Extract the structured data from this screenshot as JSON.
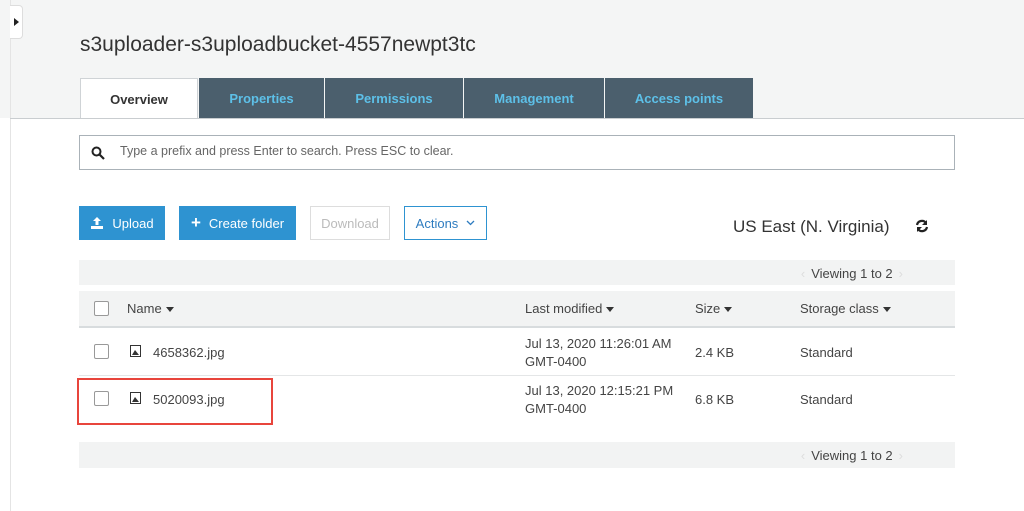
{
  "bucket_title": "s3uploader-s3uploadbucket-4557newpt3tc",
  "tabs": [
    {
      "label": "Overview",
      "active": true
    },
    {
      "label": "Properties"
    },
    {
      "label": "Permissions"
    },
    {
      "label": "Management"
    },
    {
      "label": "Access points"
    }
  ],
  "search": {
    "placeholder": "Type a prefix and press Enter to search. Press ESC to clear.",
    "value": ""
  },
  "toolbar": {
    "upload": "Upload",
    "create_folder": "Create folder",
    "download": "Download",
    "actions": "Actions"
  },
  "region": "US East (N. Virginia)",
  "pagination": {
    "top": "Viewing 1 to 2",
    "bottom": "Viewing 1 to 2"
  },
  "columns": {
    "name": "Name",
    "last_modified": "Last modified",
    "size": "Size",
    "storage_class": "Storage class"
  },
  "rows": [
    {
      "name": "4658362.jpg",
      "modified_line1": "Jul 13, 2020 11:26:01 AM",
      "modified_line2": "GMT-0400",
      "size": "2.4 KB",
      "storage_class": "Standard"
    },
    {
      "name": "5020093.jpg",
      "modified_line1": "Jul 13, 2020 12:15:21 PM",
      "modified_line2": "GMT-0400",
      "size": "6.8 KB",
      "storage_class": "Standard",
      "highlighted": true
    }
  ],
  "colors": {
    "tab_bg": "#4b5f6d",
    "tab_text": "#5dc0e8",
    "primary": "#2e93d1",
    "highlight": "#e8453c"
  }
}
